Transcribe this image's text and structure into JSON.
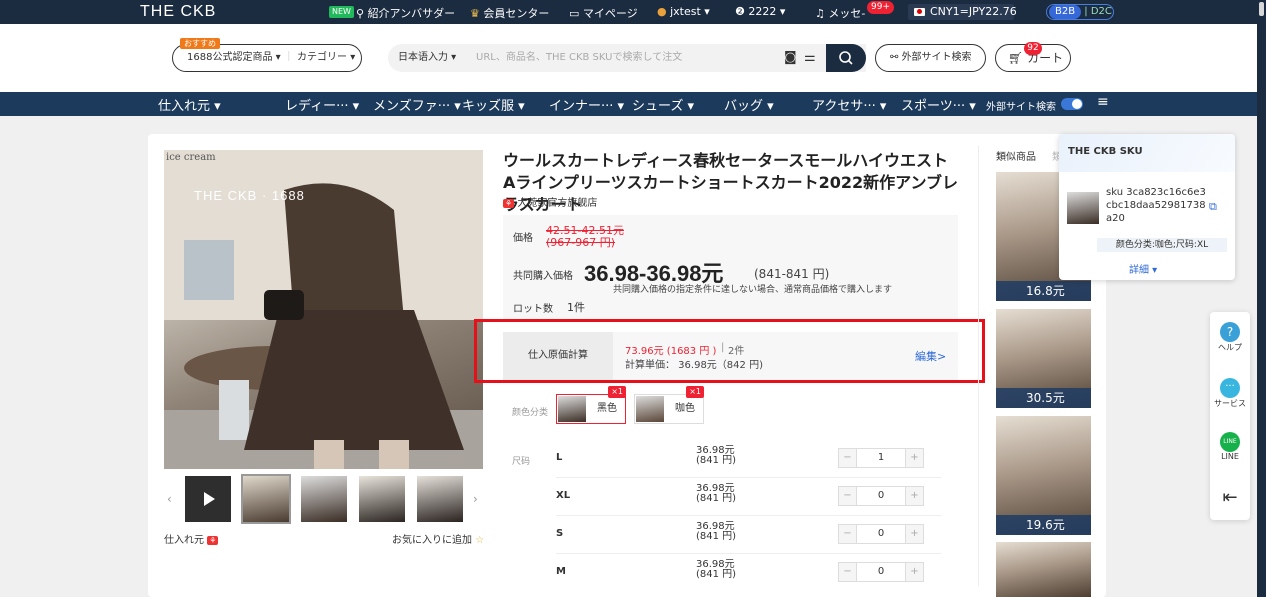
{
  "topbar": {
    "logo": "THE CKB",
    "new_badge": "NEW",
    "ambassador": "紹介アンバサダー",
    "member_center": "会員センター",
    "my_page": "マイページ",
    "user": "jxtest ▾",
    "points": "2222 ▾",
    "message": "メッセ-",
    "message_badge": "99+",
    "currency": "CNY1=JPY22.76",
    "b2b": "B2B",
    "d2c": "D2C"
  },
  "header": {
    "osusume": "おすすめ",
    "certified": "1688公式認定商品 ▾",
    "category": "カテゴリー ▾",
    "lang": "日本语入力 ▾",
    "search_placeholder": "URL、商品名、THE CKB SKUで検索して注文",
    "external_search": "外部サイト検索",
    "cart": "カート",
    "cart_badge": "92"
  },
  "nav": {
    "items": [
      "仕入れ元 ▾",
      "レディー··· ▾",
      "メンズファ··· ▾",
      "キッズ服 ▾",
      "インナー··· ▾",
      "シューズ ▾",
      "バッグ ▾",
      "アクセサ··· ▾",
      "スポーツ··· ▾"
    ],
    "external": "外部サイト検索"
  },
  "gallery": {
    "watermark": "THE CKB · 1688",
    "corner_text": "ice cream",
    "supplier": "仕入れ元",
    "favorite": "お気に入りに追加"
  },
  "product": {
    "title": "ウールスカートレディース春秋セータースモールハイウエスト Aラインプリーツスカートショートスカート2022新作アンブレラスカート",
    "shop": "大菀家官方旗舰店",
    "price_label": "価格",
    "old_price": "42.51-42.51元",
    "old_price_jpy": "(967-967 円)",
    "group_label": "共同購入価格",
    "group_price": "36.98-36.98元",
    "group_price_jpy": "(841-841 円)",
    "group_note": "共同購入価格の指定条件に達しない場合、通常商品価格で購入します",
    "lot_label": "ロット数",
    "lot_value": "1件",
    "calc_label": "仕入原価計算",
    "calc_total": "73.96元 (1683 円 )",
    "calc_qty": "2件",
    "calc_unit": "計算単価： 36.98元（842 円)",
    "edit": "編集>",
    "color_label": "颜色分类",
    "colors": [
      {
        "name": "黑色",
        "badge": "×1"
      },
      {
        "name": "咖色",
        "badge": "×1"
      }
    ],
    "size_label": "尺码",
    "sizes": [
      {
        "size": "L",
        "price": "36.98元",
        "jpy": "(841 円)",
        "qty": "1"
      },
      {
        "size": "XL",
        "price": "36.98元",
        "jpy": "(841 円)",
        "qty": "0"
      },
      {
        "size": "S",
        "price": "36.98元",
        "jpy": "(841 円)",
        "qty": "0"
      },
      {
        "size": "M",
        "price": "36.98元",
        "jpy": "(841 円)",
        "qty": "0"
      }
    ]
  },
  "similar": {
    "title": "類似商品",
    "title_cut": "類",
    "prices": [
      "16.8元",
      "30.5元",
      "19.6元"
    ]
  },
  "sku_popup": {
    "title": "THE CKB SKU",
    "sku": "sku 3ca823c16c6e3cbc18daa52981738a20",
    "spec": "颜色分类:咖色;尺码:XL",
    "detail": "詳細 ▾"
  },
  "side": {
    "help": "ヘルプ",
    "service": "サービス",
    "line": "LINE",
    "line_logo": "LINE"
  }
}
